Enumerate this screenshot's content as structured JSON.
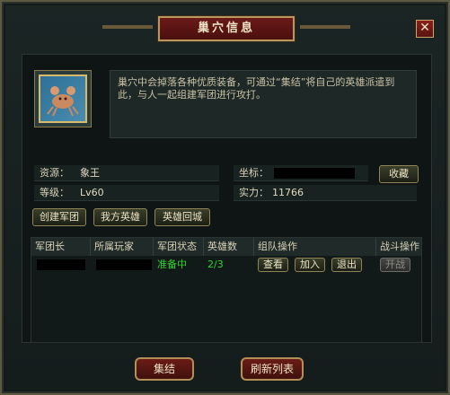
{
  "window": {
    "title": "巢穴信息",
    "close_label": "✕"
  },
  "lair": {
    "icon": "lair-crab-icon",
    "description": "巢穴中会掉落各种优质装备，可通过“集结”将自己的英雄派遣到此，与人一起组建军团进行攻打。",
    "resource_label": "资源：",
    "resource_value": "象王",
    "level_label": "等级：",
    "level_value": "Lv60",
    "coord_label": "坐标：",
    "coord_value": "",
    "power_label": "实力：",
    "power_value": "11766",
    "favorite_label": "收藏"
  },
  "tabs": [
    {
      "label": "创建军团"
    },
    {
      "label": "我方英雄"
    },
    {
      "label": "英雄回城"
    }
  ],
  "table": {
    "columns": [
      "军团长",
      "所属玩家",
      "军团状态",
      "英雄数",
      "组队操作",
      "战斗操作"
    ],
    "rows": [
      {
        "leader": "",
        "player": "",
        "status": "准备中",
        "heroes": "2/3",
        "actions": [
          "查看",
          "加入",
          "退出"
        ],
        "battle": "开战"
      }
    ]
  },
  "footer": {
    "gather_label": "集结",
    "refresh_label": "刷新列表"
  },
  "colors": {
    "status_ready": "#2fd52f",
    "title_plate": "#6a1a18",
    "gold_border": "#b7985e"
  }
}
